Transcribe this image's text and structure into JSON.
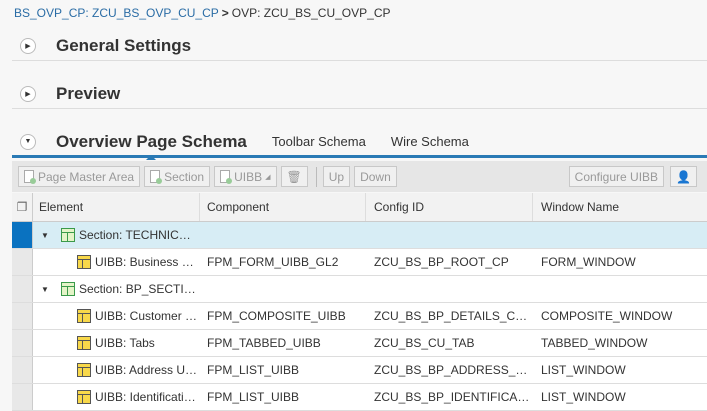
{
  "breadcrumb": {
    "link": "BS_OVP_CP: ZCU_BS_OVP_CU_CP",
    "separator": ">",
    "current": "OVP: ZCU_BS_CU_OVP_CP"
  },
  "panels": {
    "general": "General Settings",
    "preview": "Preview"
  },
  "tabs": [
    {
      "label": "Overview Page Schema"
    },
    {
      "label": "Toolbar Schema"
    },
    {
      "label": "Wire Schema"
    }
  ],
  "toolbar": {
    "page_master_area": "Page Master Area",
    "section": "Section",
    "uibb": "UIBB",
    "up": "Up",
    "down": "Down",
    "configure_uibb": "Configure UIBB"
  },
  "table": {
    "columns": [
      "Element",
      "Component",
      "Config ID",
      "Window Name"
    ],
    "rows": [
      {
        "type": "section",
        "element": "Section: TECHNIC…",
        "component": "",
        "config": "",
        "window": "",
        "selected": true
      },
      {
        "type": "uibb",
        "element": "UIBB: Business …",
        "component": "FPM_FORM_UIBB_GL2",
        "config": "ZCU_BS_BP_ROOT_CP",
        "window": "FORM_WINDOW"
      },
      {
        "type": "section",
        "element": "Section: BP_SECTI…",
        "component": "",
        "config": "",
        "window": ""
      },
      {
        "type": "uibb",
        "element": "UIBB: Customer …",
        "component": "FPM_COMPOSITE_UIBB",
        "config": "ZCU_BS_BP_DETAILS_C…",
        "window": "COMPOSITE_WINDOW"
      },
      {
        "type": "uibb",
        "element": "UIBB: Tabs",
        "component": "FPM_TABBED_UIBB",
        "config": "ZCU_BS_CU_TAB",
        "window": "TABBED_WINDOW"
      },
      {
        "type": "uibb",
        "element": "UIBB: Address U…",
        "component": "FPM_LIST_UIBB",
        "config": "ZCU_BS_BP_ADDRESS_…",
        "window": "LIST_WINDOW"
      },
      {
        "type": "uibb",
        "element": "UIBB: Identificati…",
        "component": "FPM_LIST_UIBB",
        "config": "ZCU_BS_BP_IDENTIFICA…",
        "window": "LIST_WINDOW"
      }
    ]
  }
}
